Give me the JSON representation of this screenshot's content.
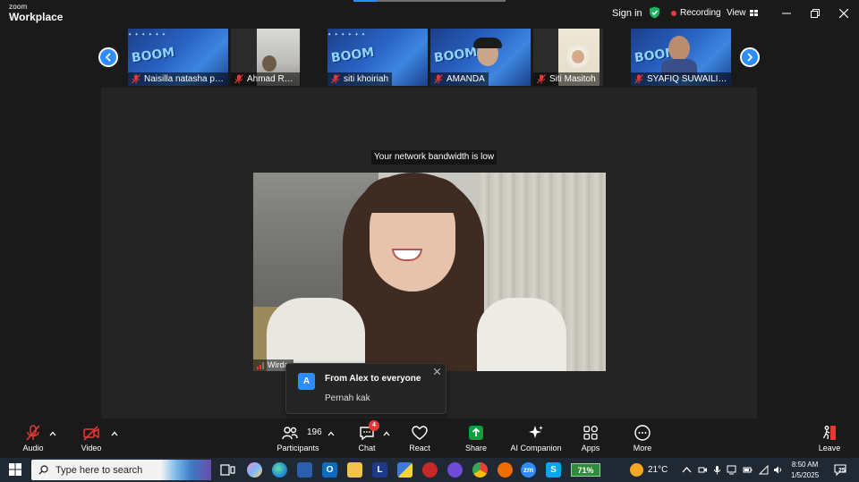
{
  "app": {
    "logo_top": "zoom",
    "logo_bottom": "Workplace"
  },
  "titlebar": {
    "sign_in": "Sign in",
    "recording": "Recording",
    "view": "View",
    "progress": 0.15
  },
  "thumbnails": [
    {
      "name": "Naisilla natasha putri ...",
      "type": "poster",
      "muted": true
    },
    {
      "name": "Ahmad Royyan",
      "type": "camera",
      "muted": true
    },
    {
      "name": "siti khoiriah",
      "type": "poster",
      "muted": true
    },
    {
      "name": "AMANDA",
      "type": "camera-poster",
      "muted": true
    },
    {
      "name": "Siti Masitoh",
      "type": "camera",
      "muted": true
    },
    {
      "name": "SYAFIQ SUWAILIM AW...",
      "type": "camera-poster",
      "muted": true
    }
  ],
  "poster_word": "BOOM",
  "stage": {
    "banner": "Your network bandwidth is low",
    "speaker_name": "Wirda"
  },
  "chat_toast": {
    "avatar_letter": "A",
    "from": "From Alex to everyone",
    "message": "Pernah kak"
  },
  "toolbar": {
    "audio": "Audio",
    "video": "Video",
    "participants": "Participants",
    "participants_count": "196",
    "chat": "Chat",
    "chat_badge": "4",
    "react": "React",
    "share": "Share",
    "ai_companion": "AI Companion",
    "apps": "Apps",
    "more": "More",
    "leave": "Leave"
  },
  "taskbar": {
    "search_placeholder": "Type here to search",
    "battery": "71%",
    "temperature": "21°C",
    "time": "8:50 AM",
    "date": "1/5/2025",
    "notifications": "25"
  },
  "colors": {
    "accent": "#2d8cff",
    "mute_red": "#e53935",
    "recording_red": "#e53935",
    "share_green": "#0e9f3e",
    "shield_green": "#18b55a"
  }
}
